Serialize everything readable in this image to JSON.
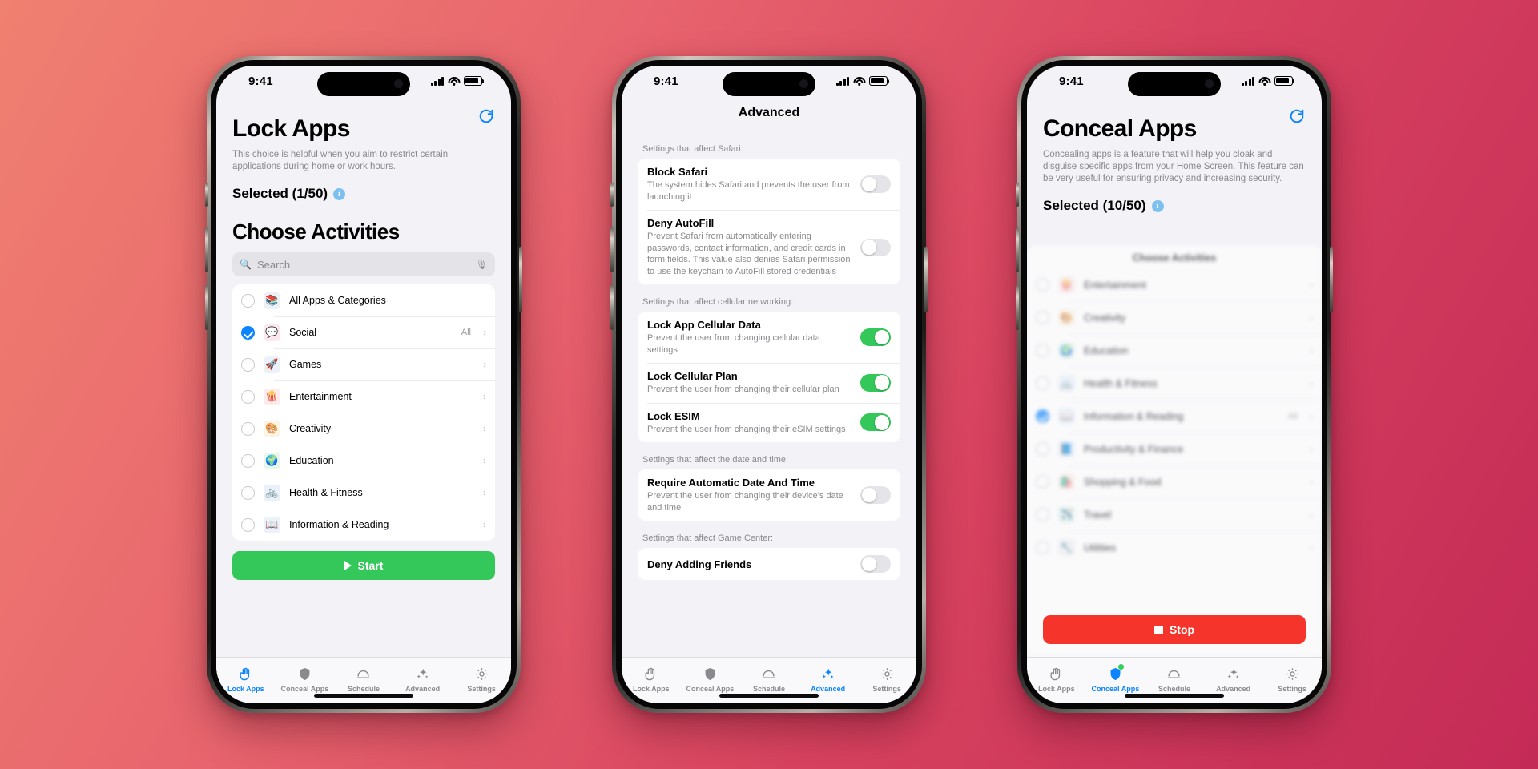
{
  "common": {
    "status_time": "9:41",
    "search_placeholder": "Search",
    "mic_icon": "microphone-icon",
    "search_icon": "search-icon",
    "refresh_icon": "refresh-icon",
    "info_icon": "info-circle-icon",
    "chevron": "›",
    "accent_blue": "#0a84ff",
    "green": "#34c759",
    "red": "#f5342b"
  },
  "tabs": [
    {
      "label": "Lock Apps",
      "icon": "hand-raised-icon"
    },
    {
      "label": "Conceal Apps",
      "icon": "shield-icon"
    },
    {
      "label": "Schedule",
      "icon": "schedule-arc-icon"
    },
    {
      "label": "Advanced",
      "icon": "sparkles-icon"
    },
    {
      "label": "Settings",
      "icon": "gear-icon"
    }
  ],
  "phone1": {
    "title": "Lock Apps",
    "subtitle": "This choice is helpful when you aim to restrict certain applications during home or work hours.",
    "selected_label": "Selected (1/50)",
    "section_title": "Choose Activities",
    "active_tab": 0,
    "cta": {
      "label": "Start",
      "style": "start",
      "icon": "play-icon"
    },
    "rows": [
      {
        "label": "All Apps & Categories",
        "checked": false,
        "emoji": "📚",
        "bg": "#eef0f4",
        "trailing": "",
        "chevron": false
      },
      {
        "label": "Social",
        "checked": true,
        "emoji": "💬",
        "bg": "#fde7ee",
        "trailing": "All",
        "chevron": true
      },
      {
        "label": "Games",
        "checked": false,
        "emoji": "🚀",
        "bg": "#eaf1fb",
        "trailing": "",
        "chevron": true
      },
      {
        "label": "Entertainment",
        "checked": false,
        "emoji": "🍿",
        "bg": "#fdeceb",
        "trailing": "",
        "chevron": true
      },
      {
        "label": "Creativity",
        "checked": false,
        "emoji": "🎨",
        "bg": "#fdf4e3",
        "trailing": "",
        "chevron": true
      },
      {
        "label": "Education",
        "checked": false,
        "emoji": "🌍",
        "bg": "#e9f6ec",
        "trailing": "",
        "chevron": true
      },
      {
        "label": "Health & Fitness",
        "checked": false,
        "emoji": "🚲",
        "bg": "#e9f2fb",
        "trailing": "",
        "chevron": true
      },
      {
        "label": "Information & Reading",
        "checked": false,
        "emoji": "📖",
        "bg": "#e8f3fc",
        "trailing": "",
        "chevron": true
      }
    ]
  },
  "phone2": {
    "nav_title": "Advanced",
    "active_tab": 3,
    "groups": [
      {
        "label": "Settings that affect Safari:",
        "items": [
          {
            "title": "Block Safari",
            "desc": "The system hides Safari and prevents the user from launching it",
            "on": false
          },
          {
            "title": "Deny AutoFill",
            "desc": "Prevent Safari from automatically entering passwords, contact information, and credit cards in form fields. This value also denies Safari permission to use the keychain to AutoFill stored credentials",
            "on": false
          }
        ]
      },
      {
        "label": "Settings that affect cellular networking:",
        "items": [
          {
            "title": "Lock App Cellular Data",
            "desc": "Prevent the user from changing cellular data settings",
            "on": true
          },
          {
            "title": "Lock Cellular Plan",
            "desc": "Prevent the user from changing their cellular plan",
            "on": true
          },
          {
            "title": "Lock ESIM",
            "desc": "Prevent the user from changing their eSIM settings",
            "on": true
          }
        ]
      },
      {
        "label": "Settings that affect the date and time:",
        "items": [
          {
            "title": "Require Automatic Date And Time",
            "desc": "Prevent the user from changing their device's date and time",
            "on": false
          }
        ]
      },
      {
        "label": "Settings that affect Game Center:",
        "items": [
          {
            "title": "Deny Adding Friends",
            "desc": "",
            "on": false
          }
        ]
      }
    ]
  },
  "phone3": {
    "title": "Conceal Apps",
    "subtitle": "Concealing apps is a feature that will help you cloak and disguise specific apps from your Home Screen. This feature can be very useful for ensuring privacy and increasing security.",
    "selected_label": "Selected (10/50)",
    "sheet_title": "Choose Activities",
    "active_tab": 1,
    "cta": {
      "label": "Stop",
      "style": "stop",
      "icon": "stop-square-icon"
    },
    "rows": [
      {
        "label": "Entertainment",
        "checked": false,
        "emoji": "🍿",
        "bg": "#fdeceb",
        "trailing": "",
        "chevron": true
      },
      {
        "label": "Creativity",
        "checked": false,
        "emoji": "🎨",
        "bg": "#fdf4e3",
        "trailing": "",
        "chevron": true
      },
      {
        "label": "Education",
        "checked": false,
        "emoji": "🌍",
        "bg": "#e9f6ec",
        "trailing": "",
        "chevron": true
      },
      {
        "label": "Health & Fitness",
        "checked": false,
        "emoji": "🚲",
        "bg": "#e9f2fb",
        "trailing": "",
        "chevron": true
      },
      {
        "label": "Information & Reading",
        "checked": true,
        "emoji": "📖",
        "bg": "#e8f3fc",
        "trailing": "All",
        "chevron": true
      },
      {
        "label": "Productivity & Finance",
        "checked": false,
        "emoji": "📘",
        "bg": "#e8f1fd",
        "trailing": "",
        "chevron": true
      },
      {
        "label": "Shopping & Food",
        "checked": false,
        "emoji": "🛍️",
        "bg": "#fdf0e6",
        "trailing": "",
        "chevron": true
      },
      {
        "label": "Travel",
        "checked": false,
        "emoji": "✈️",
        "bg": "#e9f6ec",
        "trailing": "",
        "chevron": true
      },
      {
        "label": "Utilities",
        "checked": false,
        "emoji": "🔧",
        "bg": "#f0f0f2",
        "trailing": "",
        "chevron": true
      }
    ]
  }
}
